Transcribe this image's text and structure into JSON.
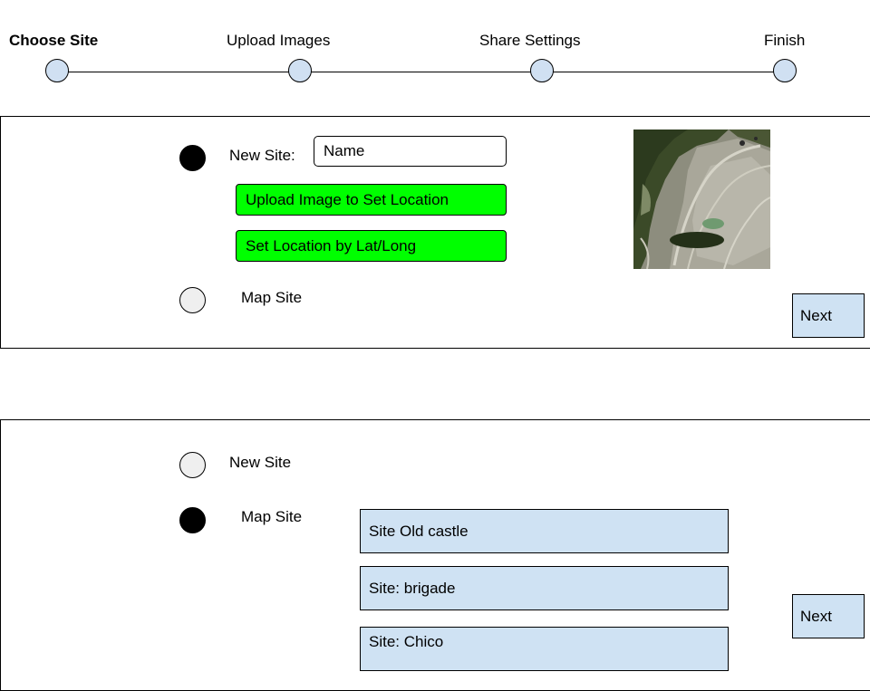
{
  "stepper": {
    "steps": [
      {
        "label": "Choose Site",
        "active": true
      },
      {
        "label": "Upload Images",
        "active": false
      },
      {
        "label": "Share Settings",
        "active": false
      },
      {
        "label": "Finish",
        "active": false
      }
    ]
  },
  "colors": {
    "step_dot": "#d0e0f2",
    "radio_unselected": "#efefef",
    "radio_selected": "#000000",
    "green_button": "#00ff00",
    "next_button": "#cfe2f3",
    "site_item": "#cfe2f3"
  },
  "panel_new_site": {
    "new_site_radio_selected": true,
    "new_site_label": "New Site:",
    "name_placeholder": "Name",
    "upload_button": "Upload Image to Set Location",
    "latlong_button": "Set Location by Lat/Long",
    "map_site_radio_selected": false,
    "map_site_label": "Map Site",
    "next_button": "Next"
  },
  "panel_map_site": {
    "new_site_radio_selected": false,
    "new_site_label": "New Site",
    "map_site_radio_selected": true,
    "map_site_label": "Map Site",
    "sites": [
      "Site Old castle",
      "Site: brigade",
      "Site: Chico"
    ],
    "next_button": "Next"
  }
}
